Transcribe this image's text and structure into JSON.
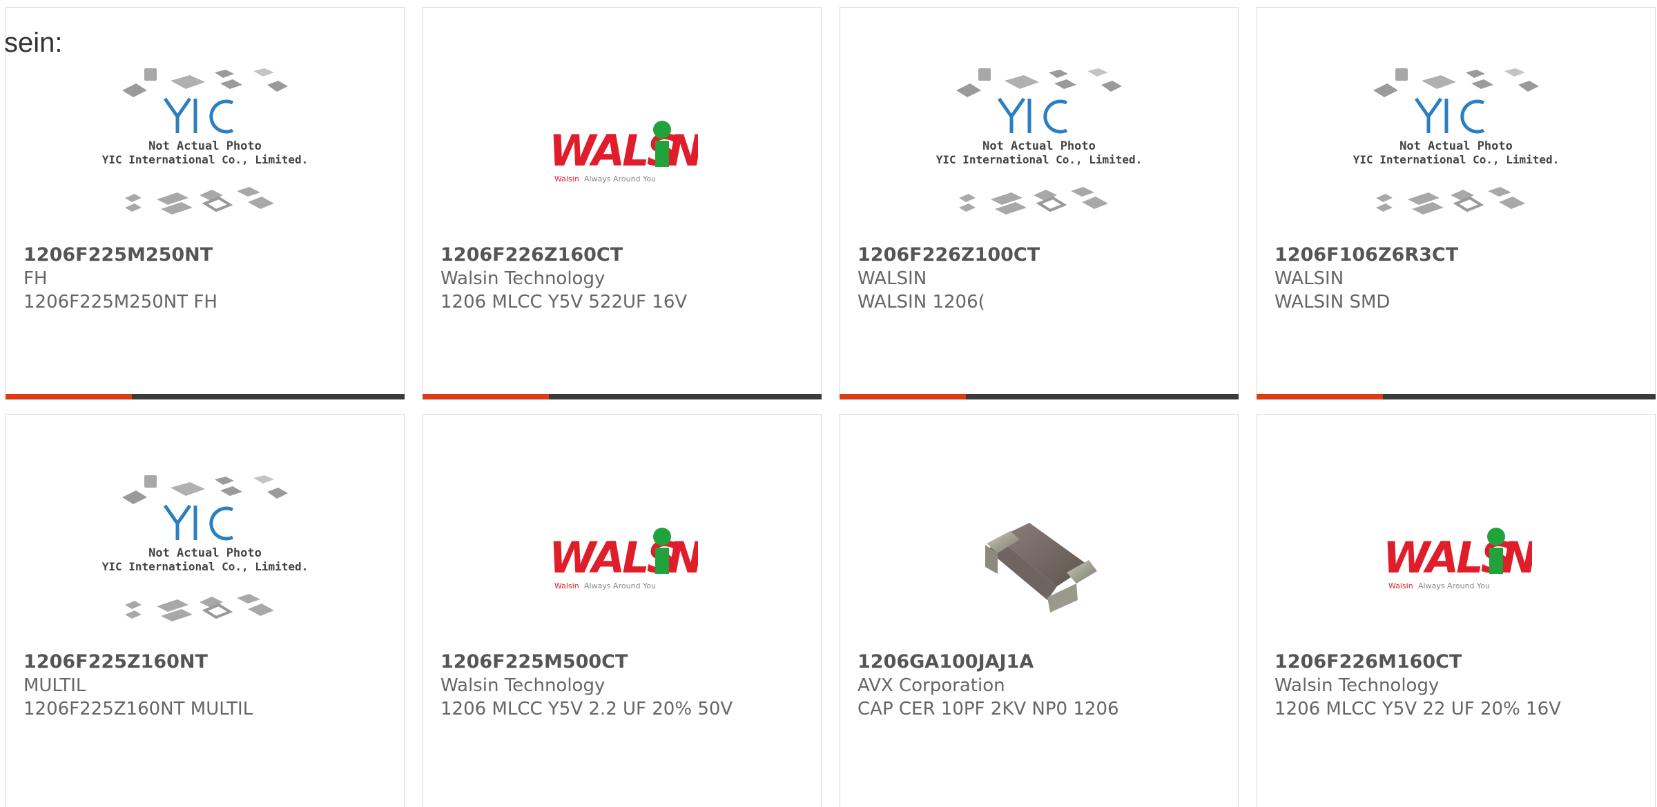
{
  "page": {
    "heading_fragment": "sein:"
  },
  "yic_logo": {
    "brand": "YIC",
    "line1": "Not Actual Photo",
    "line2": "YIC International Co., Limited."
  },
  "walsin_logo": {
    "brand": "WALSIN",
    "tag_brand": "Walsin",
    "tag_rest": " Always Around You"
  },
  "colors": {
    "accent": "#e03a12",
    "bar": "#3a3a3a",
    "walsin_red": "#e01e2b",
    "walsin_green": "#1fa33a",
    "yic_blue": "#2b7fc0"
  },
  "products": [
    {
      "part": "1206F225M250NT",
      "mfr": "FH",
      "desc": "1206F225M250NT FH",
      "image": "yic-placeholder"
    },
    {
      "part": "1206F226Z160CT",
      "mfr": "Walsin Technology",
      "desc": "1206 MLCC Y5V 522UF 16V",
      "image": "walsin-logo"
    },
    {
      "part": "1206F226Z100CT",
      "mfr": "WALSIN",
      "desc": "WALSIN 1206(",
      "image": "yic-placeholder"
    },
    {
      "part": "1206F106Z6R3CT",
      "mfr": "WALSIN",
      "desc": "WALSIN SMD",
      "image": "yic-placeholder"
    },
    {
      "part": "1206F225Z160NT",
      "mfr": "MULTIL",
      "desc": "1206F225Z160NT MULTIL",
      "image": "yic-placeholder"
    },
    {
      "part": "1206F225M500CT",
      "mfr": "Walsin Technology",
      "desc": "1206 MLCC Y5V 2.2 UF 20% 50V",
      "image": "walsin-logo"
    },
    {
      "part": "1206GA100JAJ1A",
      "mfr": "AVX Corporation",
      "desc": "CAP CER 10PF 2KV NP0 1206",
      "image": "capacitor-photo"
    },
    {
      "part": "1206F226M160CT",
      "mfr": "Walsin Technology",
      "desc": "1206 MLCC Y5V 22 UF 20% 16V",
      "image": "walsin-logo"
    }
  ]
}
